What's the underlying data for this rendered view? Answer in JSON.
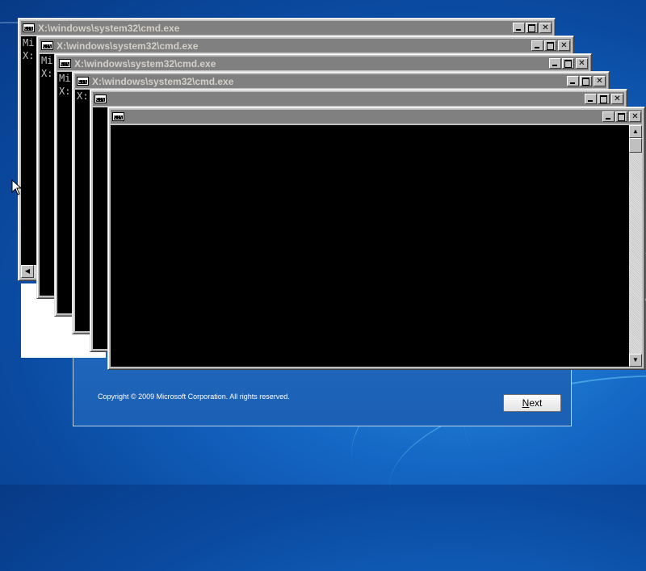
{
  "setup_dialog": {
    "copyright": "Copyright © 2009 Microsoft Corporation. All rights reserved.",
    "next_prefix": "",
    "next_underlined": "N",
    "next_rest": "ext"
  },
  "cmd_windows": [
    {
      "title": "X:\\windows\\system32\\cmd.exe",
      "lines": [
        "Mi",
        "",
        "X:"
      ]
    },
    {
      "title": "X:\\windows\\system32\\cmd.exe",
      "lines": [
        "Mi",
        "",
        "X:"
      ]
    },
    {
      "title": "X:\\windows\\system32\\cmd.exe",
      "lines": [
        "Mi",
        "",
        "X:"
      ]
    },
    {
      "title": "X:\\windows\\system32\\cmd.exe",
      "lines": [
        "",
        "",
        "X:"
      ]
    },
    {
      "title": "",
      "lines": []
    },
    {
      "title": "",
      "lines": []
    }
  ],
  "icons": {
    "window_icon": "console-icon",
    "minimize": "minimize-icon",
    "maximize": "maximize-icon",
    "close": "close-icon",
    "cursor": "mouse-pointer-icon"
  },
  "colors": {
    "titlebar_inactive": "#808080",
    "console_bg": "#000000",
    "desktop": "#1466c4"
  }
}
